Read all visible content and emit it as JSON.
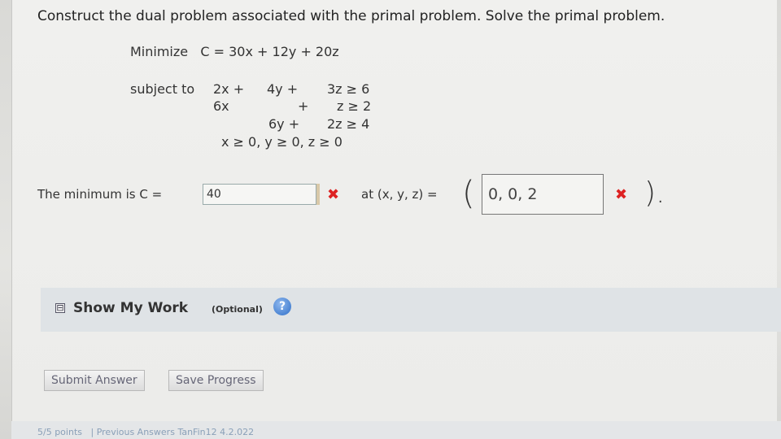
{
  "question": "Construct the dual problem associated with the primal problem. Solve the primal problem.",
  "objective": "Minimize   C = 30x + 12y + 20z",
  "subject_to": "subject to",
  "constraints": [
    {
      "c1": "2x +",
      "c2": "4y +",
      "c3": "3z ≥ 6"
    },
    {
      "c1": "6x",
      "c2": "+",
      "c3": "z ≥ 2"
    },
    {
      "c1": "",
      "c2": "6y +",
      "c3": "2z ≥ 4"
    }
  ],
  "nonneg": "x ≥ 0, y ≥ 0, z ≥ 0",
  "answer": {
    "min_label": "The minimum is C =",
    "c_value": "40",
    "at_label": "at (x, y, z) =",
    "xyz_value": "0, 0, 2",
    "wrong_mark": "✖",
    "open_paren": "(",
    "close_paren": ").",
    "wrong_color": "#dd2222"
  },
  "show_work": {
    "toggle": "⊟",
    "title": "Show My Work",
    "optional": "(Optional)",
    "help": "?"
  },
  "buttons": {
    "submit": "Submit Answer",
    "save": "Save Progress"
  },
  "footer": {
    "points": "5/5 points",
    "separator": "|",
    "previous": "Previous Answers",
    "course": "TanFin12 4.2.022"
  }
}
